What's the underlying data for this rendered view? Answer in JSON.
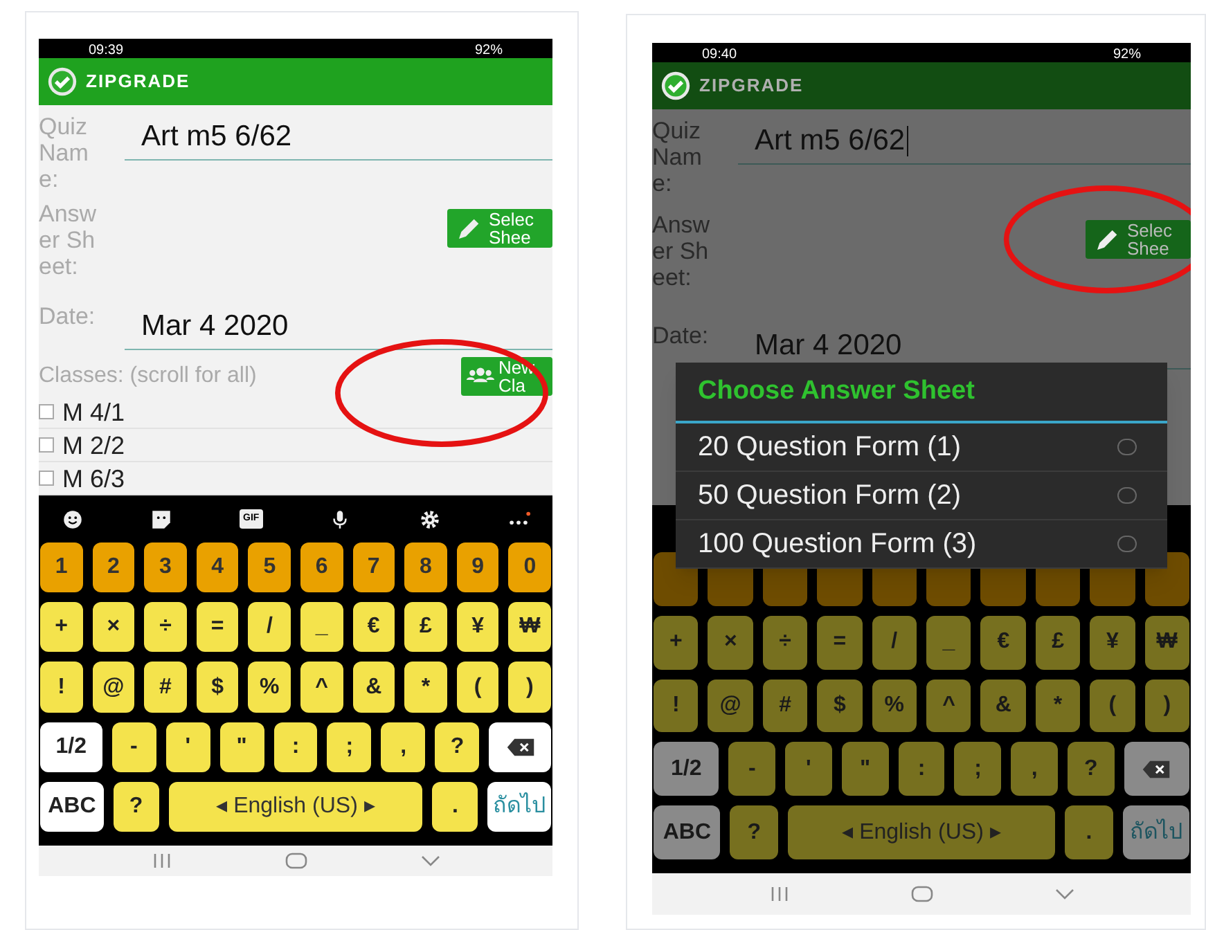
{
  "phones": [
    {
      "status_bar": {
        "time": "09:39",
        "battery": "92%"
      },
      "app_bar": {
        "title": "ZIPGRADE"
      },
      "dimmed": false,
      "form": {
        "fields": [
          {
            "kind": "text",
            "label": "Quiz Name:",
            "value": "Art m5 6/62",
            "focused": false
          },
          {
            "kind": "button",
            "label": "Answer Sheet:",
            "button": [
              "Selec",
              "Shee"
            ],
            "highlighted": false
          },
          {
            "kind": "text",
            "label": "Date:",
            "value": "Mar 4 2020",
            "focused": false
          }
        ],
        "classes": {
          "label": "Classes: (scroll for all)",
          "button": [
            "New",
            "Cla"
          ],
          "highlighted": true,
          "items": [
            {
              "name": "M 4/1",
              "checked": false
            },
            {
              "name": "M 2/2",
              "checked": false
            },
            {
              "name": "M 6/3",
              "checked": false
            }
          ]
        }
      },
      "keyboard": {
        "toolbar": {
          "gif": "GIF"
        },
        "rows": [
          {
            "keys": [
              {
                "kind": "number",
                "label": "1"
              },
              {
                "kind": "number",
                "label": "2"
              },
              {
                "kind": "number",
                "label": "3"
              },
              {
                "kind": "number",
                "label": "4"
              },
              {
                "kind": "number",
                "label": "5"
              },
              {
                "kind": "number",
                "label": "6"
              },
              {
                "kind": "number",
                "label": "7"
              },
              {
                "kind": "number",
                "label": "8"
              },
              {
                "kind": "number",
                "label": "9"
              },
              {
                "kind": "number",
                "label": "0"
              }
            ]
          },
          {
            "keys": [
              {
                "kind": "symbol",
                "label": "+"
              },
              {
                "kind": "symbol",
                "label": "×"
              },
              {
                "kind": "symbol",
                "label": "÷"
              },
              {
                "kind": "symbol",
                "label": "="
              },
              {
                "kind": "symbol",
                "label": "/"
              },
              {
                "kind": "symbol",
                "label": "_"
              },
              {
                "kind": "symbol",
                "label": "€"
              },
              {
                "kind": "symbol",
                "label": "£"
              },
              {
                "kind": "symbol",
                "label": "¥"
              },
              {
                "kind": "symbol",
                "label": "₩"
              }
            ]
          },
          {
            "keys": [
              {
                "kind": "symbol",
                "label": "!"
              },
              {
                "kind": "symbol",
                "label": "@"
              },
              {
                "kind": "symbol",
                "label": "#"
              },
              {
                "kind": "symbol",
                "label": "$"
              },
              {
                "kind": "symbol",
                "label": "%"
              },
              {
                "kind": "symbol",
                "label": "^"
              },
              {
                "kind": "symbol",
                "label": "&"
              },
              {
                "kind": "symbol",
                "label": "*"
              },
              {
                "kind": "symbol",
                "label": "("
              },
              {
                "kind": "symbol",
                "label": ")"
              }
            ]
          },
          {
            "keys": [
              {
                "kind": "function",
                "label": "1/2"
              },
              {
                "kind": "symbol",
                "label": "-"
              },
              {
                "kind": "symbol",
                "label": "'"
              },
              {
                "kind": "symbol",
                "label": "\""
              },
              {
                "kind": "symbol",
                "label": ":"
              },
              {
                "kind": "symbol",
                "label": ";"
              },
              {
                "kind": "symbol",
                "label": ","
              },
              {
                "kind": "symbol",
                "label": "?"
              },
              {
                "kind": "backspace"
              }
            ]
          },
          {
            "keys": [
              {
                "kind": "function",
                "label": "ABC"
              },
              {
                "kind": "symbol",
                "label": "?"
              },
              {
                "kind": "space",
                "label": "◂ English (US) ▸"
              },
              {
                "kind": "symbol",
                "label": "."
              },
              {
                "kind": "enter",
                "label": "ถัดไป"
              }
            ]
          }
        ]
      }
    },
    {
      "status_bar": {
        "time": "09:40",
        "battery": "92%"
      },
      "app_bar": {
        "title": "ZIPGRADE"
      },
      "dimmed": true,
      "form": {
        "fields": [
          {
            "kind": "text",
            "label": "Quiz Name:",
            "value": "Art m5 6/62",
            "focused": true
          },
          {
            "kind": "button",
            "label": "Answer Sheet:",
            "button": [
              "Selec",
              "Shee"
            ],
            "highlighted": true
          },
          {
            "kind": "text",
            "label": "Date:",
            "value": "Mar 4 2020",
            "focused": false
          }
        ]
      },
      "dialog": {
        "title": "Choose Answer Sheet",
        "options": [
          {
            "label": "20 Question Form (1)",
            "selected": false
          },
          {
            "label": "50 Question Form (2)",
            "selected": false
          },
          {
            "label": "100 Question Form (3)",
            "selected": false
          }
        ]
      },
      "keyboard": {
        "rows": [
          {
            "keys": [
              {
                "kind": "number"
              },
              {
                "kind": "number"
              },
              {
                "kind": "number"
              },
              {
                "kind": "number"
              },
              {
                "kind": "number"
              },
              {
                "kind": "number"
              },
              {
                "kind": "number"
              },
              {
                "kind": "number"
              },
              {
                "kind": "number"
              },
              {
                "kind": "number"
              }
            ]
          },
          {
            "keys": [
              {
                "kind": "symbol",
                "label": "+"
              },
              {
                "kind": "symbol",
                "label": "×"
              },
              {
                "kind": "symbol",
                "label": "÷"
              },
              {
                "kind": "symbol",
                "label": "="
              },
              {
                "kind": "symbol",
                "label": "/"
              },
              {
                "kind": "symbol",
                "label": "_"
              },
              {
                "kind": "symbol",
                "label": "€"
              },
              {
                "kind": "symbol",
                "label": "£"
              },
              {
                "kind": "symbol",
                "label": "¥"
              },
              {
                "kind": "symbol",
                "label": "₩"
              }
            ]
          },
          {
            "keys": [
              {
                "kind": "symbol",
                "label": "!"
              },
              {
                "kind": "symbol",
                "label": "@"
              },
              {
                "kind": "symbol",
                "label": "#"
              },
              {
                "kind": "symbol",
                "label": "$"
              },
              {
                "kind": "symbol",
                "label": "%"
              },
              {
                "kind": "symbol",
                "label": "^"
              },
              {
                "kind": "symbol",
                "label": "&"
              },
              {
                "kind": "symbol",
                "label": "*"
              },
              {
                "kind": "symbol",
                "label": "("
              },
              {
                "kind": "symbol",
                "label": ")"
              }
            ]
          },
          {
            "keys": [
              {
                "kind": "function",
                "label": "1/2"
              },
              {
                "kind": "symbol",
                "label": "-"
              },
              {
                "kind": "symbol",
                "label": "'"
              },
              {
                "kind": "symbol",
                "label": "\""
              },
              {
                "kind": "symbol",
                "label": ":"
              },
              {
                "kind": "symbol",
                "label": ";"
              },
              {
                "kind": "symbol",
                "label": ","
              },
              {
                "kind": "symbol",
                "label": "?"
              },
              {
                "kind": "backspace"
              }
            ]
          },
          {
            "keys": [
              {
                "kind": "function",
                "label": "ABC"
              },
              {
                "kind": "symbol",
                "label": "?"
              },
              {
                "kind": "space",
                "label": "◂ English (US) ▸"
              },
              {
                "kind": "symbol",
                "label": "."
              },
              {
                "kind": "enter",
                "label": "ถัดไป"
              }
            ]
          }
        ]
      }
    }
  ]
}
